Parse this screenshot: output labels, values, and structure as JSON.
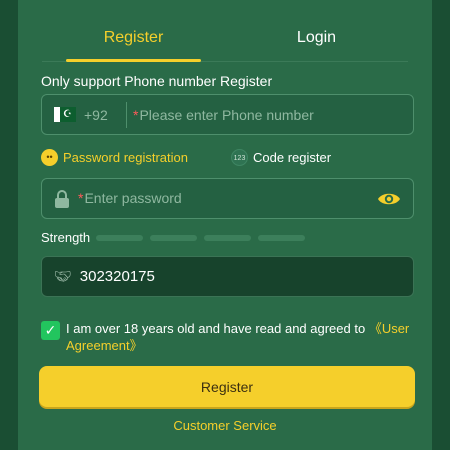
{
  "tabs": [
    {
      "label": "Register",
      "active": true
    },
    {
      "label": "Login",
      "active": false
    }
  ],
  "register": {
    "hint": "Only support Phone number Register",
    "phone": {
      "country_icon": "pakistan-flag-icon",
      "prefix": "+92",
      "required_mark": "*",
      "placeholder": "Please enter Phone number"
    },
    "options": {
      "password_label": "Password registration",
      "password_icon_text": "••",
      "code_label": "Code register",
      "code_icon_text": "123"
    },
    "password": {
      "required_mark": "*",
      "placeholder": "Enter password"
    },
    "strength": {
      "label": "Strength",
      "segments": 4,
      "filled": 0
    },
    "invite_code": {
      "value": "302320175"
    },
    "agreement": {
      "checked": true,
      "text": "I am over 18 years old and have read and agreed to ",
      "link": "《User Agreement》"
    },
    "submit_label": "Register",
    "service_link": "Customer Service"
  },
  "colors": {
    "background": "#1f5a3b",
    "panel": "#2a6b48",
    "accent": "#f5cf2b",
    "check": "#22c55e",
    "required": "#ff5a5a"
  }
}
